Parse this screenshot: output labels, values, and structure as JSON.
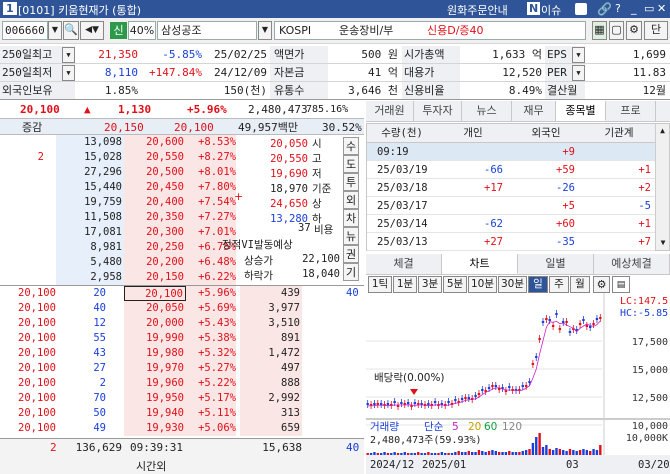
{
  "window": {
    "number": "1",
    "title": "[0101] 키움현재가 (통합)",
    "header_right": "원화주문안내",
    "news_label": "이슈"
  },
  "stock": {
    "code": "006660",
    "badge_new": "신",
    "margin_rate": "40%",
    "name": "삼성공조",
    "market": "KOSPI",
    "sector": "운송장비/부",
    "credit": "신용D/증40"
  },
  "info": {
    "r1": {
      "l1": "250일최고",
      "v1": "21,350",
      "p1": "-5.85%",
      "d1": "25/02/25",
      "l2": "액면가",
      "v2": "500 원",
      "l3": "시가총액",
      "v3": "1,633 억",
      "l4": "EPS",
      "v4": "1,699"
    },
    "r2": {
      "l1": "250일최저",
      "v1": "8,110",
      "p1": "+147.84%",
      "d1": "24/12/09",
      "l2": "자본금",
      "v2": "41 억",
      "l3": "대용가",
      "v3": "12,520",
      "l4": "PER",
      "v4": "11.83"
    },
    "r3": {
      "l1": "외국인보유",
      "v1": "1.85%",
      "d1": "150(천)",
      "l2": "유통수",
      "v2": "3,646 천",
      "l3": "신용비율",
      "v3": "8.49%",
      "l4": "결산월",
      "v4": "12월"
    }
  },
  "quote": {
    "price": "20,100",
    "arrow": "▲",
    "change": "1,130",
    "rate": "+5.96%",
    "volume": "2,480,473",
    "vol_ratio": "785.16%"
  },
  "ob_header": {
    "label": "증감",
    "price1": "20,150",
    "price2": "20,100",
    "amount": "49,957백만",
    "ratio": "30.52%"
  },
  "asks": [
    {
      "inc": "",
      "qty": "13,098",
      "price": "20,600",
      "rate": "+8.53%"
    },
    {
      "inc": "2",
      "qty": "15,028",
      "price": "20,550",
      "rate": "+8.27%"
    },
    {
      "inc": "",
      "qty": "27,296",
      "price": "20,500",
      "rate": "+8.01%"
    },
    {
      "inc": "",
      "qty": "15,440",
      "price": "20,450",
      "rate": "+7.80%"
    },
    {
      "inc": "",
      "qty": "19,759",
      "price": "20,400",
      "rate": "+7.54%"
    },
    {
      "inc": "",
      "qty": "11,508",
      "price": "20,350",
      "rate": "+7.27%"
    },
    {
      "inc": "",
      "qty": "17,081",
      "price": "20,300",
      "rate": "+7.01%"
    },
    {
      "inc": "",
      "qty": "8,981",
      "price": "20,250",
      "rate": "+6.75%"
    },
    {
      "inc": "",
      "qty": "5,480",
      "price": "20,200",
      "rate": "+6.48%"
    },
    {
      "inc": "",
      "qty": "2,958",
      "price": "20,150",
      "rate": "+6.22%"
    }
  ],
  "bids": [
    {
      "exec": "20,100",
      "qty": "20",
      "price": "20,100",
      "rate": "+5.96%",
      "bqty": "439",
      "right": "40"
    },
    {
      "exec": "20,100",
      "qty": "40",
      "price": "20,050",
      "rate": "+5.69%",
      "bqty": "3,977",
      "right": ""
    },
    {
      "exec": "20,100",
      "qty": "12",
      "price": "20,000",
      "rate": "+5.43%",
      "bqty": "3,510",
      "right": ""
    },
    {
      "exec": "20,100",
      "qty": "55",
      "price": "19,990",
      "rate": "+5.38%",
      "bqty": "891",
      "right": ""
    },
    {
      "exec": "20,100",
      "qty": "43",
      "price": "19,980",
      "rate": "+5.32%",
      "bqty": "1,472",
      "right": ""
    },
    {
      "exec": "20,100",
      "qty": "27",
      "price": "19,970",
      "rate": "+5.27%",
      "bqty": "497",
      "right": ""
    },
    {
      "exec": "20,100",
      "qty": "2",
      "price": "19,960",
      "rate": "+5.22%",
      "bqty": "888",
      "right": ""
    },
    {
      "exec": "20,100",
      "qty": "70",
      "price": "19,950",
      "rate": "+5.17%",
      "bqty": "2,992",
      "right": ""
    },
    {
      "exec": "20,100",
      "qty": "50",
      "price": "19,940",
      "rate": "+5.11%",
      "bqty": "313",
      "right": ""
    },
    {
      "exec": "20,100",
      "qty": "49",
      "price": "19,930",
      "rate": "+5.06%",
      "bqty": "659",
      "right": ""
    }
  ],
  "ob_footer": {
    "left": "2",
    "total_ask": "136,629",
    "time": "09:39:31",
    "total_bid": "15,638",
    "right": "40",
    "time_label": "시간외"
  },
  "summary": {
    "rows": [
      {
        "price": "20,050",
        "label": "시",
        "price_color": "r"
      },
      {
        "price": "20,550",
        "label": "고",
        "price_color": "r"
      },
      {
        "price": "19,690",
        "label": "저",
        "price_color": "r"
      },
      {
        "price": "18,970",
        "label": "기준",
        "price_color": "k"
      },
      {
        "price": "24,650",
        "label": "상",
        "price_color": "r"
      },
      {
        "price": "13,280",
        "label": "하",
        "price_color": "b"
      }
    ],
    "vi_count": "37",
    "vi_label": "비용",
    "vi_title": "정적VI발동예상",
    "vi_up_label": "상승가",
    "vi_up": "22,100",
    "vi_dn_label": "하락가",
    "vi_dn": "18,040"
  },
  "side_buttons": [
    "수",
    "도",
    "투",
    "외",
    "차",
    "뉴",
    "권",
    "기"
  ],
  "tabs_top": [
    "거래원",
    "투자자",
    "뉴스",
    "재무",
    "종목별",
    "프로"
  ],
  "investor_table": {
    "headers": [
      "수량(천)",
      "개인",
      "외국인",
      "기관계"
    ],
    "rows": [
      {
        "date": "09:19",
        "ind": "",
        "frn": "+9",
        "inst": ""
      },
      {
        "date": "25/03/19",
        "ind": "-66",
        "frn": "+59",
        "inst": "+1"
      },
      {
        "date": "25/03/18",
        "ind": "+17",
        "frn": "-26",
        "inst": "+2"
      },
      {
        "date": "25/03/17",
        "ind": "",
        "frn": "+5",
        "inst": "-5"
      },
      {
        "date": "25/03/14",
        "ind": "-62",
        "frn": "+60",
        "inst": "+1"
      },
      {
        "date": "25/03/13",
        "ind": "+27",
        "frn": "-35",
        "inst": "+7"
      }
    ]
  },
  "tabs_bottom": [
    "체결",
    "차트",
    "일별",
    "예상체결"
  ],
  "chart_toolbar": [
    "1틱",
    "1분",
    "3분",
    "5분",
    "10분",
    "30분",
    "일",
    "주",
    "월"
  ],
  "chart": {
    "lc": "LC:147.5",
    "hc": "HC:-5.85",
    "yticks": [
      "17,500",
      "15,000",
      "12,500",
      "10,000"
    ],
    "annotation": "배당락(0.00%)",
    "vol_legend": "거래량",
    "vol_mode": "단순",
    "ma": [
      "5",
      "20",
      "60",
      "120"
    ],
    "vol_value": "2,480,473주(59.93%)",
    "vol_tick": "10,000K",
    "xticks": [
      "2024/12",
      "2025/01",
      "03",
      "03/20"
    ],
    "colors": {
      "up": "#e0101a",
      "down": "#1a40d8"
    }
  }
}
